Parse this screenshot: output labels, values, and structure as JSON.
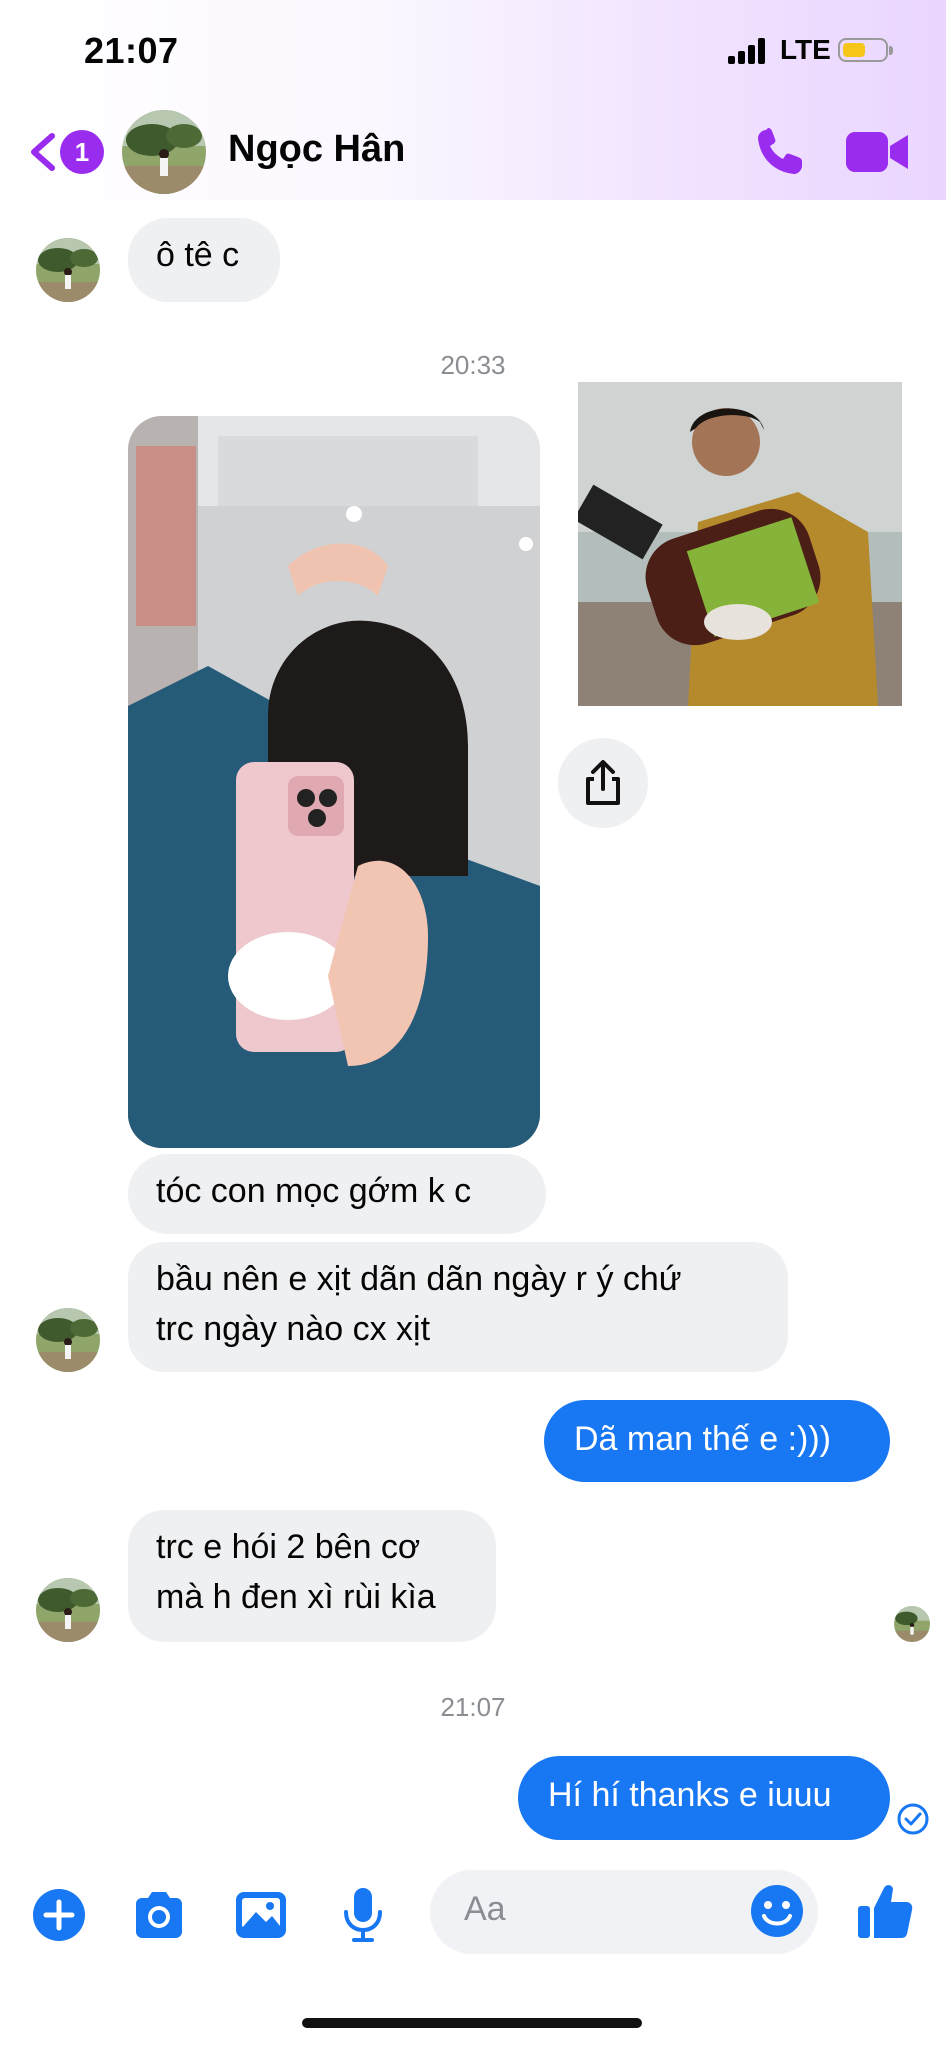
{
  "status_bar": {
    "time": "21:07",
    "network": "LTE"
  },
  "header": {
    "back_badge_count": "1",
    "contact_name": "Ngọc Hân",
    "icons": [
      "back-chevron-icon",
      "phone-icon",
      "video-camera-icon"
    ]
  },
  "messages": [
    {
      "dir": "in",
      "text": "ô tê c"
    },
    {
      "dir": "time",
      "text": "20:33"
    },
    {
      "dir": "in",
      "type": "photo",
      "description": "selfie"
    },
    {
      "dir": "in",
      "text": "tóc con mọc gớm k c"
    },
    {
      "dir": "in",
      "line1": "bầu nên e xịt dãn dãn ngày r ý chứ",
      "line2": "trc ngày nào cx xịt"
    },
    {
      "dir": "out",
      "text": "Dã man thế e :)))"
    },
    {
      "dir": "in",
      "line1": "trc e hói 2 bên cơ",
      "line2": "mà h đen xì rùi kìa"
    },
    {
      "dir": "time",
      "text": "21:07"
    },
    {
      "dir": "out",
      "text": "Hí hí thanks e iuuu"
    }
  ],
  "composer": {
    "placeholder": "Aa",
    "icons": [
      "plus-icon",
      "camera-icon",
      "gallery-icon",
      "microphone-icon",
      "emoji-icon",
      "thumbs-up-icon"
    ]
  },
  "colors": {
    "accent_purple": "#9a2cf0",
    "messenger_blue": "#1877f2",
    "bubble_gray": "#eff0f2"
  }
}
